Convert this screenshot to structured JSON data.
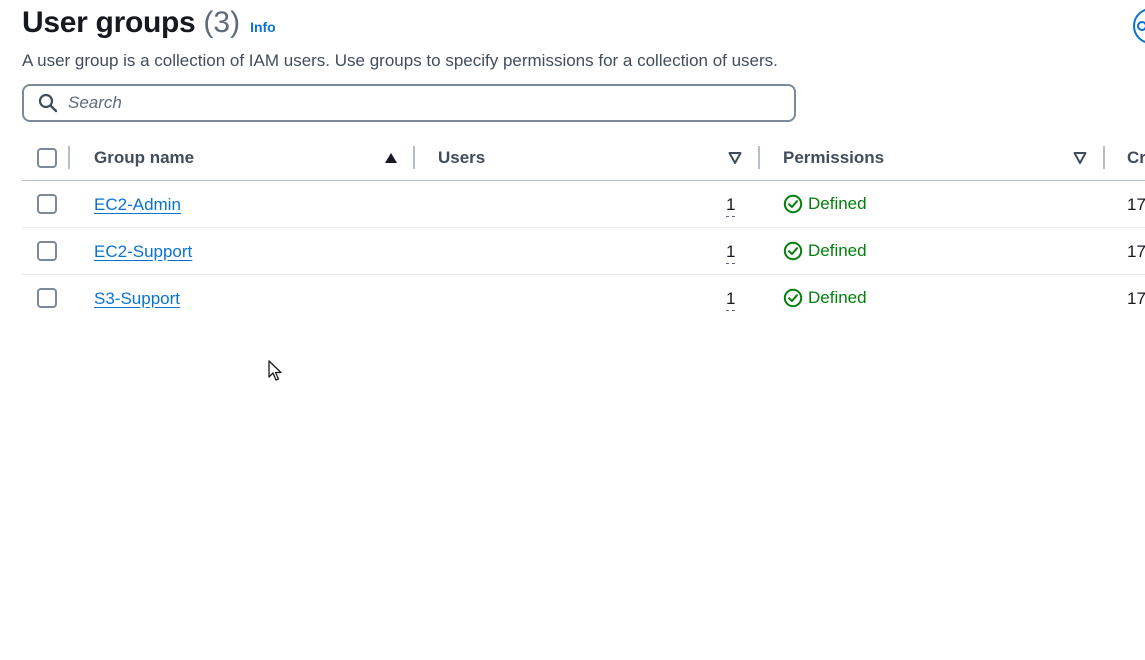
{
  "header": {
    "title": "User groups",
    "count": "(3)",
    "info_label": "Info",
    "description": "A user group is a collection of IAM users. Use groups to specify permissions for a collection of users."
  },
  "search": {
    "placeholder": "Search",
    "value": ""
  },
  "table": {
    "columns": {
      "group_name": "Group name",
      "users": "Users",
      "permissions": "Permissions",
      "created": "Cr"
    },
    "sort": {
      "column": "Group name",
      "direction": "ascending"
    },
    "rows": [
      {
        "group_name": "EC2-Admin",
        "users": "1",
        "permissions": "Defined",
        "created": "17"
      },
      {
        "group_name": "EC2-Support",
        "users": "1",
        "permissions": "Defined",
        "created": "17"
      },
      {
        "group_name": "S3-Support",
        "users": "1",
        "permissions": "Defined",
        "created": "17"
      }
    ]
  },
  "colors": {
    "link": "#0972d3",
    "success": "#037f0c",
    "text": "#16191f",
    "border": "#7d8998"
  },
  "icons": {
    "search": "search-icon",
    "sort_asc": "caret-up-filled-icon",
    "sort_none": "caret-down-outline-icon",
    "status_success": "check-circle-icon",
    "pointer": "mouse-pointer-icon"
  }
}
